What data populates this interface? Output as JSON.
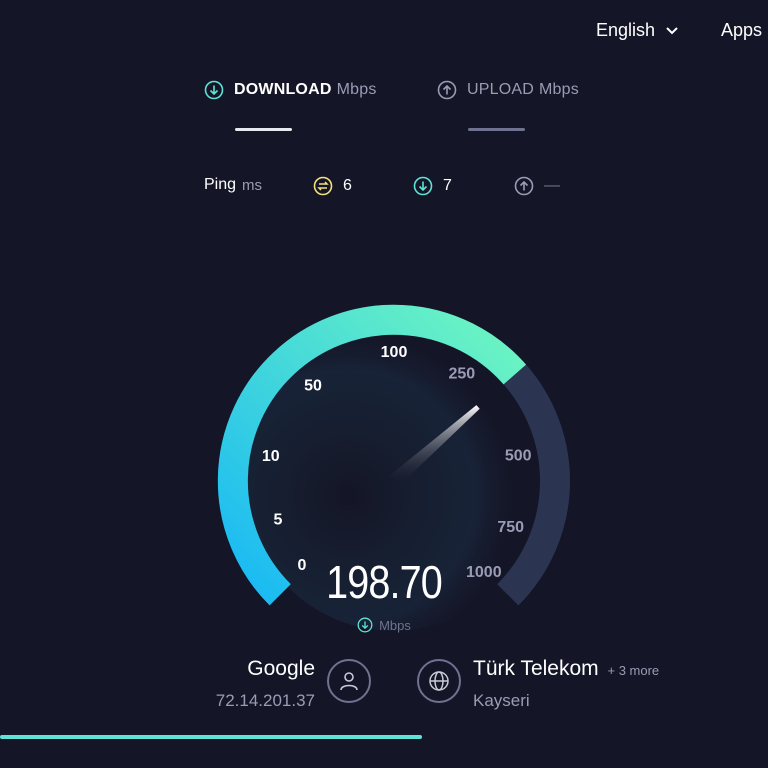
{
  "topbar": {
    "language": "English",
    "apps": "Apps"
  },
  "tabs": {
    "download": {
      "label": "DOWNLOAD",
      "unit": "Mbps"
    },
    "upload": {
      "label": "UPLOAD",
      "unit": "Mbps"
    }
  },
  "ping": {
    "label": "Ping",
    "unit": "ms",
    "idle": "6",
    "download": "7",
    "upload": "—"
  },
  "gauge": {
    "ticks": [
      "0",
      "5",
      "10",
      "50",
      "100",
      "250",
      "500",
      "750",
      "1000"
    ],
    "speed": "198.70",
    "unit": "Mbps",
    "fill_fraction": 0.68
  },
  "server": {
    "host": "Google",
    "ip": "72.14.201.37",
    "provider": "Türk Telekom",
    "more": "+ 3 more",
    "location": "Kayseri"
  },
  "progress": {
    "fraction": 0.55
  },
  "colors": {
    "background": "#141526",
    "accent": "#5fe3d6",
    "arc_start": "#17b8f5",
    "arc_end": "#6ff7c0",
    "track": "#2b3552"
  }
}
